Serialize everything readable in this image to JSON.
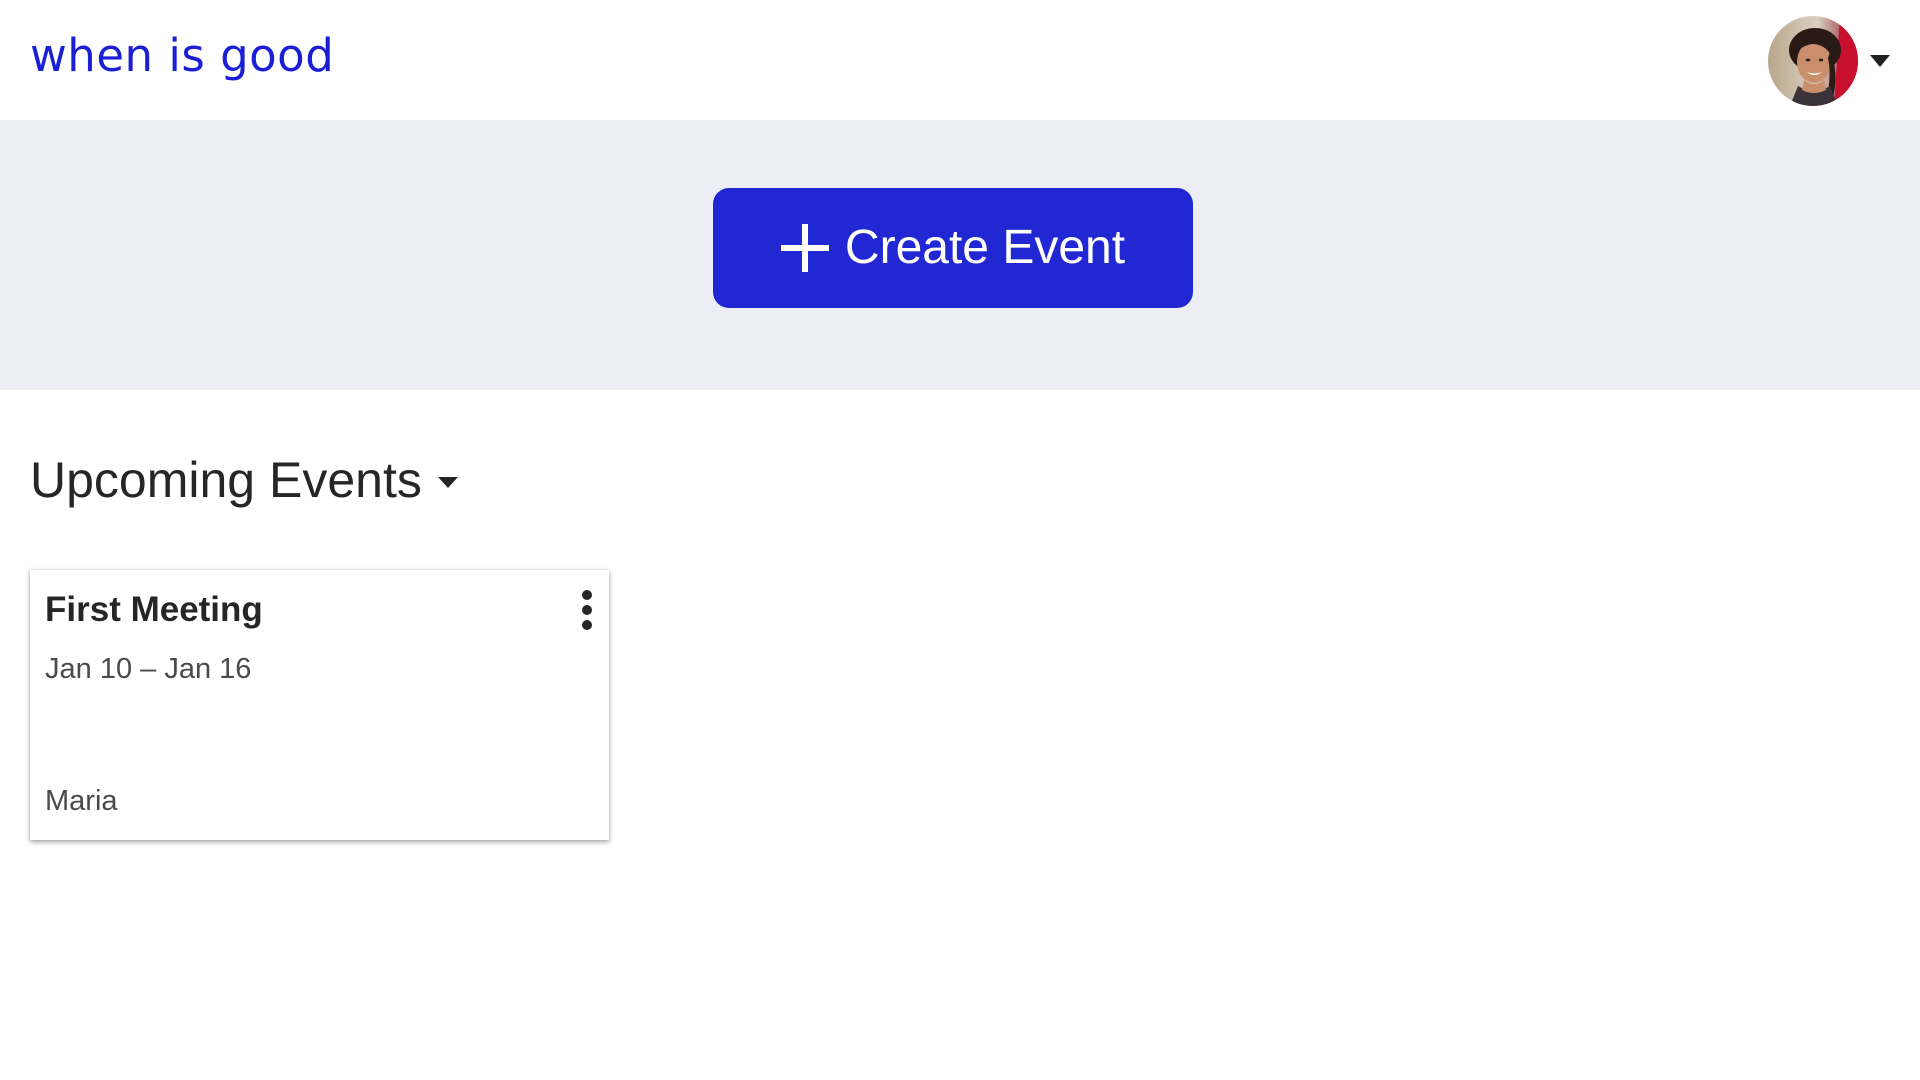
{
  "header": {
    "logo_text": "when is good",
    "avatar_icon": "user-avatar",
    "menu_caret_icon": "caret-down-icon"
  },
  "hero": {
    "create_button": {
      "label": "Create Event",
      "icon": "plus-icon",
      "color": "#2127d3"
    },
    "background_color": "#ecedf5"
  },
  "section": {
    "title": "Upcoming Events",
    "caret_icon": "caret-down-icon"
  },
  "events": [
    {
      "title": "First Meeting",
      "dates": "Jan 10 – Jan 16",
      "owner": "Maria",
      "menu_icon": "more-vertical-icon"
    }
  ],
  "colors": {
    "brand": "#1a1fd6",
    "accent": "#2127d3",
    "text": "#262626"
  }
}
